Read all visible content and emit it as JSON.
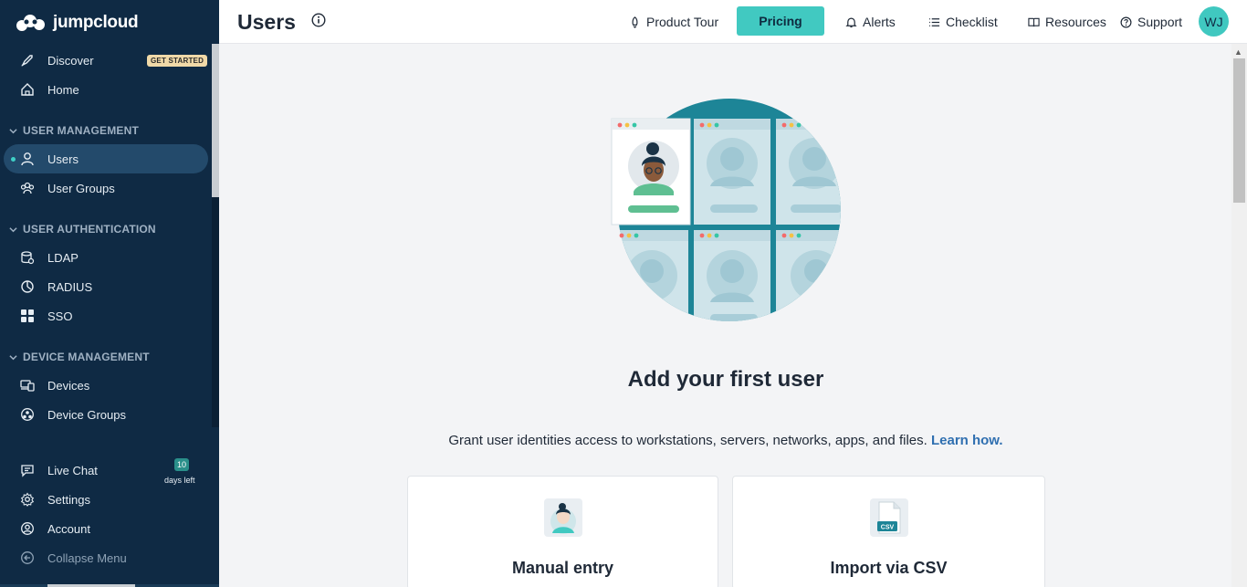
{
  "brand": {
    "name": "jumpcloud"
  },
  "sidebar": {
    "discover": {
      "label": "Discover",
      "badge": "GET STARTED"
    },
    "home": {
      "label": "Home"
    },
    "sections": {
      "user_management": "USER MANAGEMENT",
      "user_authentication": "USER AUTHENTICATION",
      "device_management": "DEVICE MANAGEMENT"
    },
    "items": {
      "users": "Users",
      "user_groups": "User Groups",
      "ldap": "LDAP",
      "radius": "RADIUS",
      "sso": "SSO",
      "devices": "Devices",
      "device_groups": "Device Groups"
    },
    "footer": {
      "live_chat": "Live Chat",
      "trial_days": "10",
      "trial_suffix": "days left",
      "settings": "Settings",
      "account": "Account",
      "collapse": "Collapse Menu"
    }
  },
  "header": {
    "title": "Users",
    "product_tour": "Product Tour",
    "pricing": "Pricing",
    "alerts": "Alerts",
    "checklist": "Checklist",
    "resources": "Resources",
    "support": "Support",
    "avatar_initials": "WJ"
  },
  "main": {
    "heading": "Add your first user",
    "description": "Grant user identities access to workstations, servers, networks, apps, and files.",
    "learn_link": "Learn how.",
    "cards": {
      "manual": {
        "title": "Manual entry"
      },
      "csv": {
        "title": "Import via CSV",
        "icon_text": "CSV"
      }
    }
  },
  "colors": {
    "sidebar_bg": "#0f2a44",
    "accent": "#41c9c1",
    "link": "#2f6fb0"
  }
}
